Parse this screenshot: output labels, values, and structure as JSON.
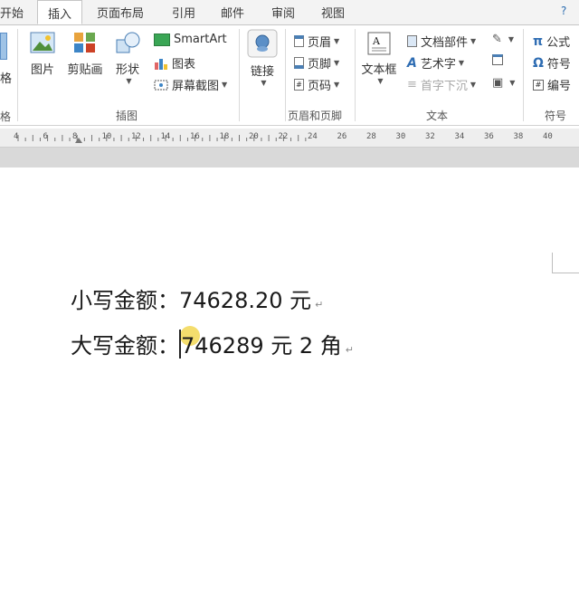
{
  "tabs": [
    "开始",
    "插入",
    "页面布局",
    "引用",
    "邮件",
    "审阅",
    "视图"
  ],
  "ribbon": {
    "illustrations": {
      "picture": "图片",
      "clipart": "剪贴画",
      "shapes": "形状",
      "smartart": "SmartArt",
      "chart": "图表",
      "screenshot": "屏幕截图",
      "group_label": "插图",
      "left_cut_label": "格",
      "left_cut_group": "格"
    },
    "links": {
      "link": "链接"
    },
    "header_footer": {
      "header": "页眉",
      "footer": "页脚",
      "page_number": "页码",
      "group_label": "页眉和页脚"
    },
    "text": {
      "textbox": "文本框",
      "quick_parts": "文档部件",
      "wordart": "艺术字",
      "dropcap": "首字下沉",
      "group_label": "文本"
    },
    "symbols": {
      "equation": "公式",
      "symbol": "符号",
      "number": "编号",
      "group_label": "符号"
    }
  },
  "ruler": [
    "4",
    "6",
    "8",
    "10",
    "12",
    "14",
    "16",
    "18",
    "20",
    "22",
    "24",
    "26",
    "28",
    "30",
    "32",
    "34",
    "36",
    "38",
    "40"
  ],
  "document": {
    "line1": "小写金额：74628.20 元",
    "line2_label": "大写金额：",
    "line2_value": "746289 元 2 角",
    "para_mark": "↵"
  },
  "colors": {
    "tab_bg": "#f3f3f3",
    "ruler_bg": "#eeeeee",
    "gap_bg": "#d9d9d9",
    "click_highlight": "#f0d23c"
  }
}
